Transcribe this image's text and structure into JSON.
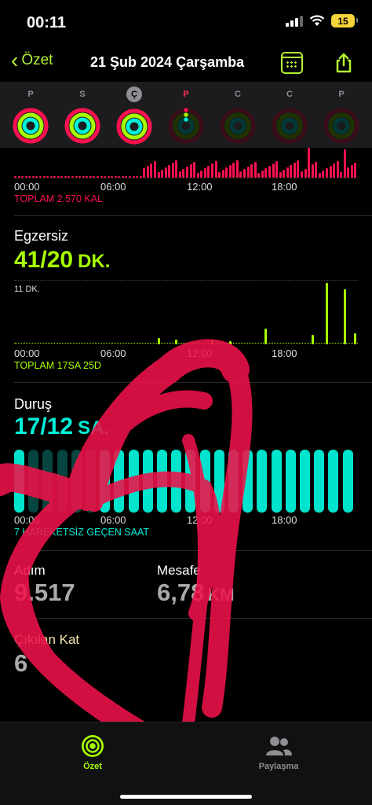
{
  "status": {
    "time": "00:11",
    "battery": "15"
  },
  "nav": {
    "back_label": "Özet",
    "title": "21 Şub 2024 Çarşamba"
  },
  "week": [
    {
      "letter": "P",
      "state": "full"
    },
    {
      "letter": "S",
      "state": "full"
    },
    {
      "letter": "Ç",
      "state": "selected"
    },
    {
      "letter": "P",
      "state": "today"
    },
    {
      "letter": "C",
      "state": "empty"
    },
    {
      "letter": "C",
      "state": "empty"
    },
    {
      "letter": "P",
      "state": "empty"
    }
  ],
  "move": {
    "axis": [
      "00:00",
      "06:00",
      "12:00",
      "18:00"
    ],
    "total": "TOPLAM 2.570 KAL"
  },
  "exercise": {
    "title": "Egzersiz",
    "value": "41/20",
    "unit": "DK.",
    "ymark": "11 DK.",
    "axis": [
      "00:00",
      "06:00",
      "12:00",
      "18:00"
    ],
    "total": "TOPLAM 17SA 25D"
  },
  "stand": {
    "title": "Duruş",
    "value": "17/12",
    "unit": "SA.",
    "axis": [
      "00:00",
      "06:00",
      "12:00",
      "18:00"
    ],
    "total": "7 HAREKETSİZ GEÇEN SAAT"
  },
  "steps": {
    "label": "Adım",
    "value": "9.517"
  },
  "distance": {
    "label": "Mesafe",
    "value": "6,78",
    "unit": "KM"
  },
  "floors": {
    "label": "Çıkılan Kat",
    "value": "6"
  },
  "tabs": {
    "summary": "Özet",
    "sharing": "Paylaşma"
  },
  "colors": {
    "move": "#fa114f",
    "exercise": "#a6ff00",
    "stand": "#00f0d8",
    "accent": "#b3f234"
  }
}
